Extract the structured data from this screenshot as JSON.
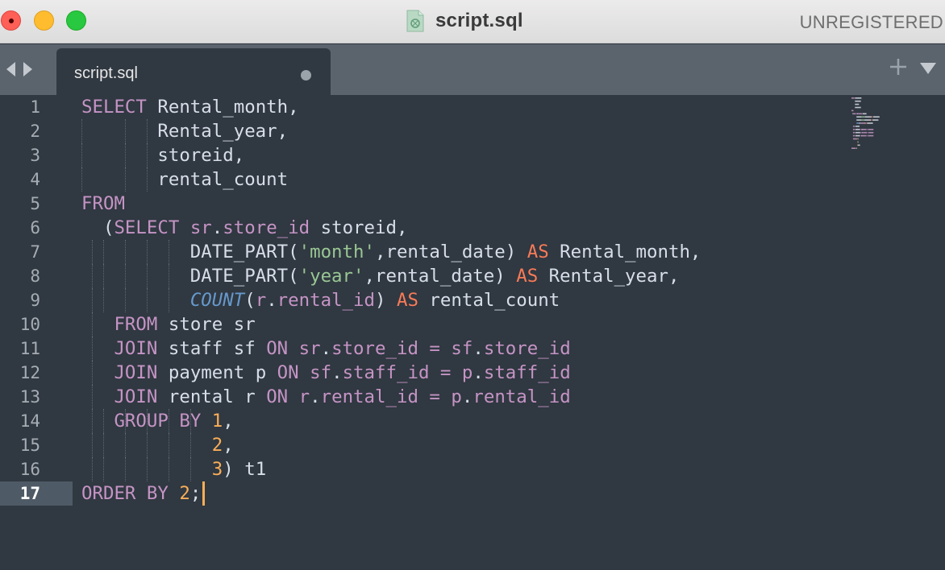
{
  "window": {
    "title": "script.sql",
    "status": "UNREGISTERED"
  },
  "tabs": [
    {
      "label": "script.sql",
      "active": true,
      "modified": true
    }
  ],
  "editor": {
    "current_line": 17,
    "line_numbers": [
      "1",
      "2",
      "3",
      "4",
      "5",
      "6",
      "7",
      "8",
      "9",
      "10",
      "11",
      "12",
      "13",
      "14",
      "15",
      "16",
      "17"
    ],
    "lines": [
      {
        "tokens": [
          {
            "t": "SELECT",
            "c": "kw"
          },
          {
            "t": " Rental_month,",
            "c": "txt"
          }
        ]
      },
      {
        "tokens": [
          {
            "t": "       Rental_year,",
            "c": "txt"
          }
        ]
      },
      {
        "tokens": [
          {
            "t": "       storeid,",
            "c": "txt"
          }
        ]
      },
      {
        "tokens": [
          {
            "t": "       rental_count",
            "c": "txt"
          }
        ]
      },
      {
        "tokens": [
          {
            "t": "FROM",
            "c": "kw"
          }
        ]
      },
      {
        "tokens": [
          {
            "t": "  (",
            "c": "txt"
          },
          {
            "t": "SELECT",
            "c": "kw"
          },
          {
            "t": " ",
            "c": "txt"
          },
          {
            "t": "sr",
            "c": "kw"
          },
          {
            "t": ".",
            "c": "txt"
          },
          {
            "t": "store_id",
            "c": "kw"
          },
          {
            "t": " storeid,",
            "c": "txt"
          }
        ]
      },
      {
        "tokens": [
          {
            "t": "          DATE_PART(",
            "c": "txt"
          },
          {
            "t": "'month'",
            "c": "str"
          },
          {
            "t": ",rental_date) ",
            "c": "txt"
          },
          {
            "t": "AS",
            "c": "op"
          },
          {
            "t": " Rental_month,",
            "c": "txt"
          }
        ]
      },
      {
        "tokens": [
          {
            "t": "          DATE_PART(",
            "c": "txt"
          },
          {
            "t": "'year'",
            "c": "str"
          },
          {
            "t": ",rental_date) ",
            "c": "txt"
          },
          {
            "t": "AS",
            "c": "op"
          },
          {
            "t": " Rental_year,",
            "c": "txt"
          }
        ]
      },
      {
        "tokens": [
          {
            "t": "          ",
            "c": "txt"
          },
          {
            "t": "COUNT",
            "c": "fn"
          },
          {
            "t": "(",
            "c": "txt"
          },
          {
            "t": "r",
            "c": "kw"
          },
          {
            "t": ".",
            "c": "txt"
          },
          {
            "t": "rental_id",
            "c": "kw"
          },
          {
            "t": ") ",
            "c": "txt"
          },
          {
            "t": "AS",
            "c": "op"
          },
          {
            "t": " rental_count",
            "c": "txt"
          }
        ]
      },
      {
        "tokens": [
          {
            "t": "   ",
            "c": "txt"
          },
          {
            "t": "FROM",
            "c": "kw"
          },
          {
            "t": " store sr",
            "c": "txt"
          }
        ]
      },
      {
        "tokens": [
          {
            "t": "   ",
            "c": "txt"
          },
          {
            "t": "JOIN",
            "c": "kw"
          },
          {
            "t": " staff sf ",
            "c": "txt"
          },
          {
            "t": "ON",
            "c": "kw"
          },
          {
            "t": " ",
            "c": "txt"
          },
          {
            "t": "sr",
            "c": "kw"
          },
          {
            "t": ".",
            "c": "txt"
          },
          {
            "t": "store_id",
            "c": "kw"
          },
          {
            "t": " ",
            "c": "txt"
          },
          {
            "t": "=",
            "c": "kw"
          },
          {
            "t": " ",
            "c": "txt"
          },
          {
            "t": "sf",
            "c": "kw"
          },
          {
            "t": ".",
            "c": "txt"
          },
          {
            "t": "store_id",
            "c": "kw"
          }
        ]
      },
      {
        "tokens": [
          {
            "t": "   ",
            "c": "txt"
          },
          {
            "t": "JOIN",
            "c": "kw"
          },
          {
            "t": " payment p ",
            "c": "txt"
          },
          {
            "t": "ON",
            "c": "kw"
          },
          {
            "t": " ",
            "c": "txt"
          },
          {
            "t": "sf",
            "c": "kw"
          },
          {
            "t": ".",
            "c": "txt"
          },
          {
            "t": "staff_id",
            "c": "kw"
          },
          {
            "t": " ",
            "c": "txt"
          },
          {
            "t": "=",
            "c": "kw"
          },
          {
            "t": " ",
            "c": "txt"
          },
          {
            "t": "p",
            "c": "kw"
          },
          {
            "t": ".",
            "c": "txt"
          },
          {
            "t": "staff_id",
            "c": "kw"
          }
        ]
      },
      {
        "tokens": [
          {
            "t": "   ",
            "c": "txt"
          },
          {
            "t": "JOIN",
            "c": "kw"
          },
          {
            "t": " rental r ",
            "c": "txt"
          },
          {
            "t": "ON",
            "c": "kw"
          },
          {
            "t": " ",
            "c": "txt"
          },
          {
            "t": "r",
            "c": "kw"
          },
          {
            "t": ".",
            "c": "txt"
          },
          {
            "t": "rental_id",
            "c": "kw"
          },
          {
            "t": " ",
            "c": "txt"
          },
          {
            "t": "=",
            "c": "kw"
          },
          {
            "t": " ",
            "c": "txt"
          },
          {
            "t": "p",
            "c": "kw"
          },
          {
            "t": ".",
            "c": "txt"
          },
          {
            "t": "rental_id",
            "c": "kw"
          }
        ]
      },
      {
        "tokens": [
          {
            "t": "   ",
            "c": "txt"
          },
          {
            "t": "GROUP BY",
            "c": "kw"
          },
          {
            "t": " ",
            "c": "txt"
          },
          {
            "t": "1",
            "c": "num"
          },
          {
            "t": ",",
            "c": "txt"
          }
        ]
      },
      {
        "tokens": [
          {
            "t": "            ",
            "c": "txt"
          },
          {
            "t": "2",
            "c": "num"
          },
          {
            "t": ",",
            "c": "txt"
          }
        ]
      },
      {
        "tokens": [
          {
            "t": "            ",
            "c": "txt"
          },
          {
            "t": "3",
            "c": "num"
          },
          {
            "t": ") t1",
            "c": "txt"
          }
        ]
      },
      {
        "tokens": [
          {
            "t": "ORDER BY",
            "c": "kw"
          },
          {
            "t": " ",
            "c": "txt"
          },
          {
            "t": "2",
            "c": "num"
          },
          {
            "t": ";",
            "c": "txt"
          }
        ]
      }
    ]
  },
  "icons": {
    "file": "sql-file-icon",
    "nav_back": "chevron-left-icon",
    "nav_forward": "chevron-right-icon",
    "new_tab": "plus-icon",
    "tab_menu": "triangle-down-icon",
    "modified": "dot-icon"
  },
  "colors": {
    "background": "#303841",
    "keyword": "#c594c5",
    "operator": "#f97b58",
    "number": "#f9ae58",
    "string": "#99c794",
    "function": "#6699cc",
    "text": "#d8dee9"
  }
}
